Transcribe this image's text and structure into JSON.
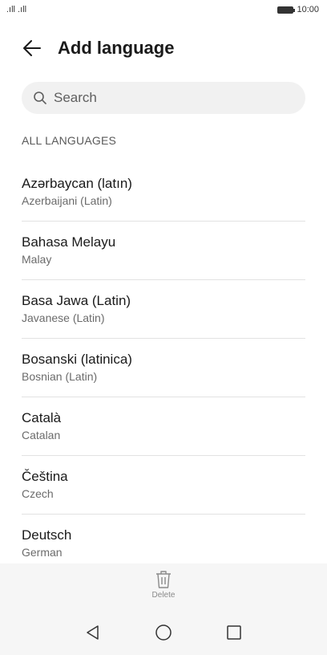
{
  "status_bar": {
    "signal_left": ".ıll .ıll",
    "time": "10:00"
  },
  "header": {
    "title": "Add language"
  },
  "search": {
    "placeholder": "Search"
  },
  "section": {
    "title": "ALL LANGUAGES"
  },
  "languages": [
    {
      "name": "Azərbaycan (latın)",
      "subtitle": "Azerbaijani (Latin)"
    },
    {
      "name": "Bahasa Melayu",
      "subtitle": "Malay"
    },
    {
      "name": "Basa Jawa (Latin)",
      "subtitle": "Javanese (Latin)"
    },
    {
      "name": "Bosanski (latinica)",
      "subtitle": "Bosnian (Latin)"
    },
    {
      "name": "Català",
      "subtitle": "Catalan"
    },
    {
      "name": "Čeština",
      "subtitle": "Czech"
    },
    {
      "name": "Deutsch",
      "subtitle": "German"
    }
  ],
  "bottom_action": {
    "label": "Delete",
    "icon": "trash-icon"
  },
  "navigation": {
    "back_icon": "triangle-back-icon",
    "home_icon": "circle-home-icon",
    "recents_icon": "square-recents-icon"
  }
}
